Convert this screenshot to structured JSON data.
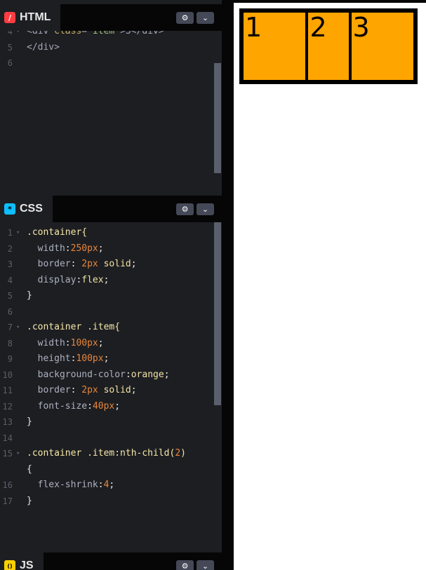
{
  "html_panel": {
    "title": "HTML",
    "icon": "html-icon",
    "icon_glyph": "/",
    "settings_glyph": "⚙",
    "collapse_glyph": "⌄",
    "lines": [
      {
        "n": "4",
        "fold": "▾",
        "text": "<div class=\"item\">3</div>"
      },
      {
        "n": "5",
        "fold": "",
        "text": "</div>"
      },
      {
        "n": "6",
        "fold": "",
        "text": ""
      }
    ]
  },
  "css_panel": {
    "title": "CSS",
    "icon": "css-icon",
    "icon_glyph": "*",
    "settings_glyph": "⚙",
    "collapse_glyph": "⌄",
    "lines": [
      {
        "n": "1",
        "fold": "▾",
        "text": ".container{"
      },
      {
        "n": "2",
        "fold": "",
        "text": "  width:250px;"
      },
      {
        "n": "3",
        "fold": "",
        "text": "  border: 2px solid;"
      },
      {
        "n": "4",
        "fold": "",
        "text": "  display:flex;"
      },
      {
        "n": "5",
        "fold": "",
        "text": "}"
      },
      {
        "n": "6",
        "fold": "",
        "text": ""
      },
      {
        "n": "7",
        "fold": "▾",
        "text": ".container .item{"
      },
      {
        "n": "8",
        "fold": "",
        "text": "  width:100px;"
      },
      {
        "n": "9",
        "fold": "",
        "text": "  height:100px;"
      },
      {
        "n": "10",
        "fold": "",
        "text": "  background-color:orange;"
      },
      {
        "n": "11",
        "fold": "",
        "text": "  border: 2px solid;"
      },
      {
        "n": "12",
        "fold": "",
        "text": "  font-size:40px;"
      },
      {
        "n": "13",
        "fold": "",
        "text": "}"
      },
      {
        "n": "14",
        "fold": "",
        "text": ""
      },
      {
        "n": "15",
        "fold": "▾",
        "text": ".container .item:nth-child(2)"
      },
      {
        "n": "",
        "fold": "",
        "text": "{"
      },
      {
        "n": "16",
        "fold": "",
        "text": "  flex-shrink:4;"
      },
      {
        "n": "17",
        "fold": "",
        "text": "}"
      }
    ]
  },
  "js_panel": {
    "title": "JS",
    "icon": "js-icon",
    "icon_glyph": "()",
    "settings_glyph": "⚙",
    "collapse_glyph": "⌄"
  },
  "preview": {
    "items": [
      "1",
      "2",
      "3"
    ],
    "item_color": "#ffa500",
    "border_color": "#000000"
  },
  "colors": {
    "editor_bg": "#1d1e22",
    "chrome_bg": "#060606",
    "button_bg": "#444857",
    "scrollbar": "#5b5f6c"
  }
}
